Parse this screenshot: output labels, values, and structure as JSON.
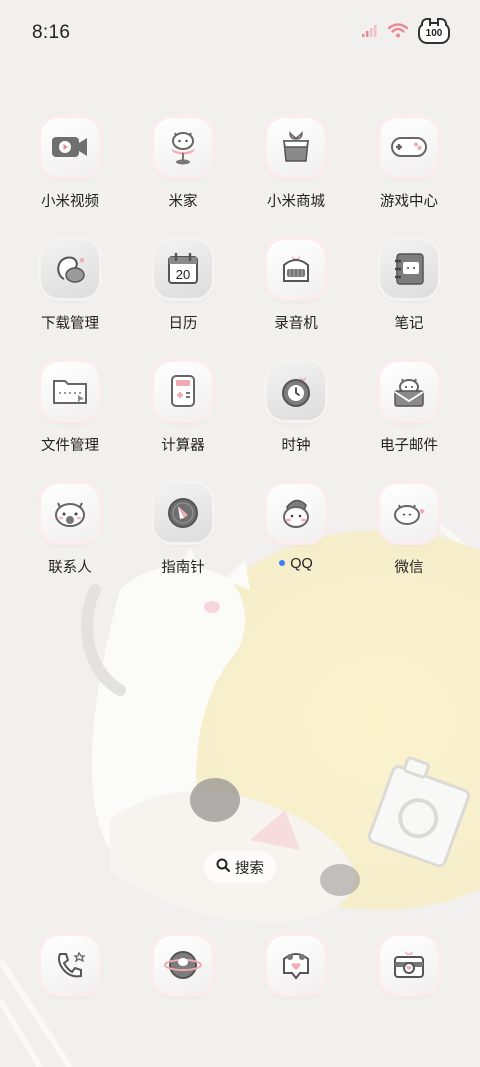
{
  "status_bar": {
    "time": "8:16",
    "battery": "100"
  },
  "apps": [
    {
      "id": "mi-video",
      "label": "小米视频"
    },
    {
      "id": "mijia",
      "label": "米家"
    },
    {
      "id": "mi-store",
      "label": "小米商城"
    },
    {
      "id": "game-center",
      "label": "游戏中心"
    },
    {
      "id": "downloads",
      "label": "下载管理"
    },
    {
      "id": "calendar",
      "label": "日历",
      "date": "20"
    },
    {
      "id": "recorder",
      "label": "录音机"
    },
    {
      "id": "notes",
      "label": "笔记"
    },
    {
      "id": "file-manager",
      "label": "文件管理"
    },
    {
      "id": "calculator",
      "label": "计算器"
    },
    {
      "id": "clock",
      "label": "时钟"
    },
    {
      "id": "email",
      "label": "电子邮件"
    },
    {
      "id": "contacts",
      "label": "联系人"
    },
    {
      "id": "compass",
      "label": "指南针"
    },
    {
      "id": "qq",
      "label": "QQ"
    },
    {
      "id": "wechat",
      "label": "微信"
    }
  ],
  "search": {
    "label": "搜索"
  },
  "dock": [
    {
      "id": "phone",
      "icon": "phone-icon"
    },
    {
      "id": "browser",
      "icon": "browser-icon"
    },
    {
      "id": "messages",
      "icon": "messages-icon"
    },
    {
      "id": "camera",
      "icon": "camera-icon"
    }
  ]
}
